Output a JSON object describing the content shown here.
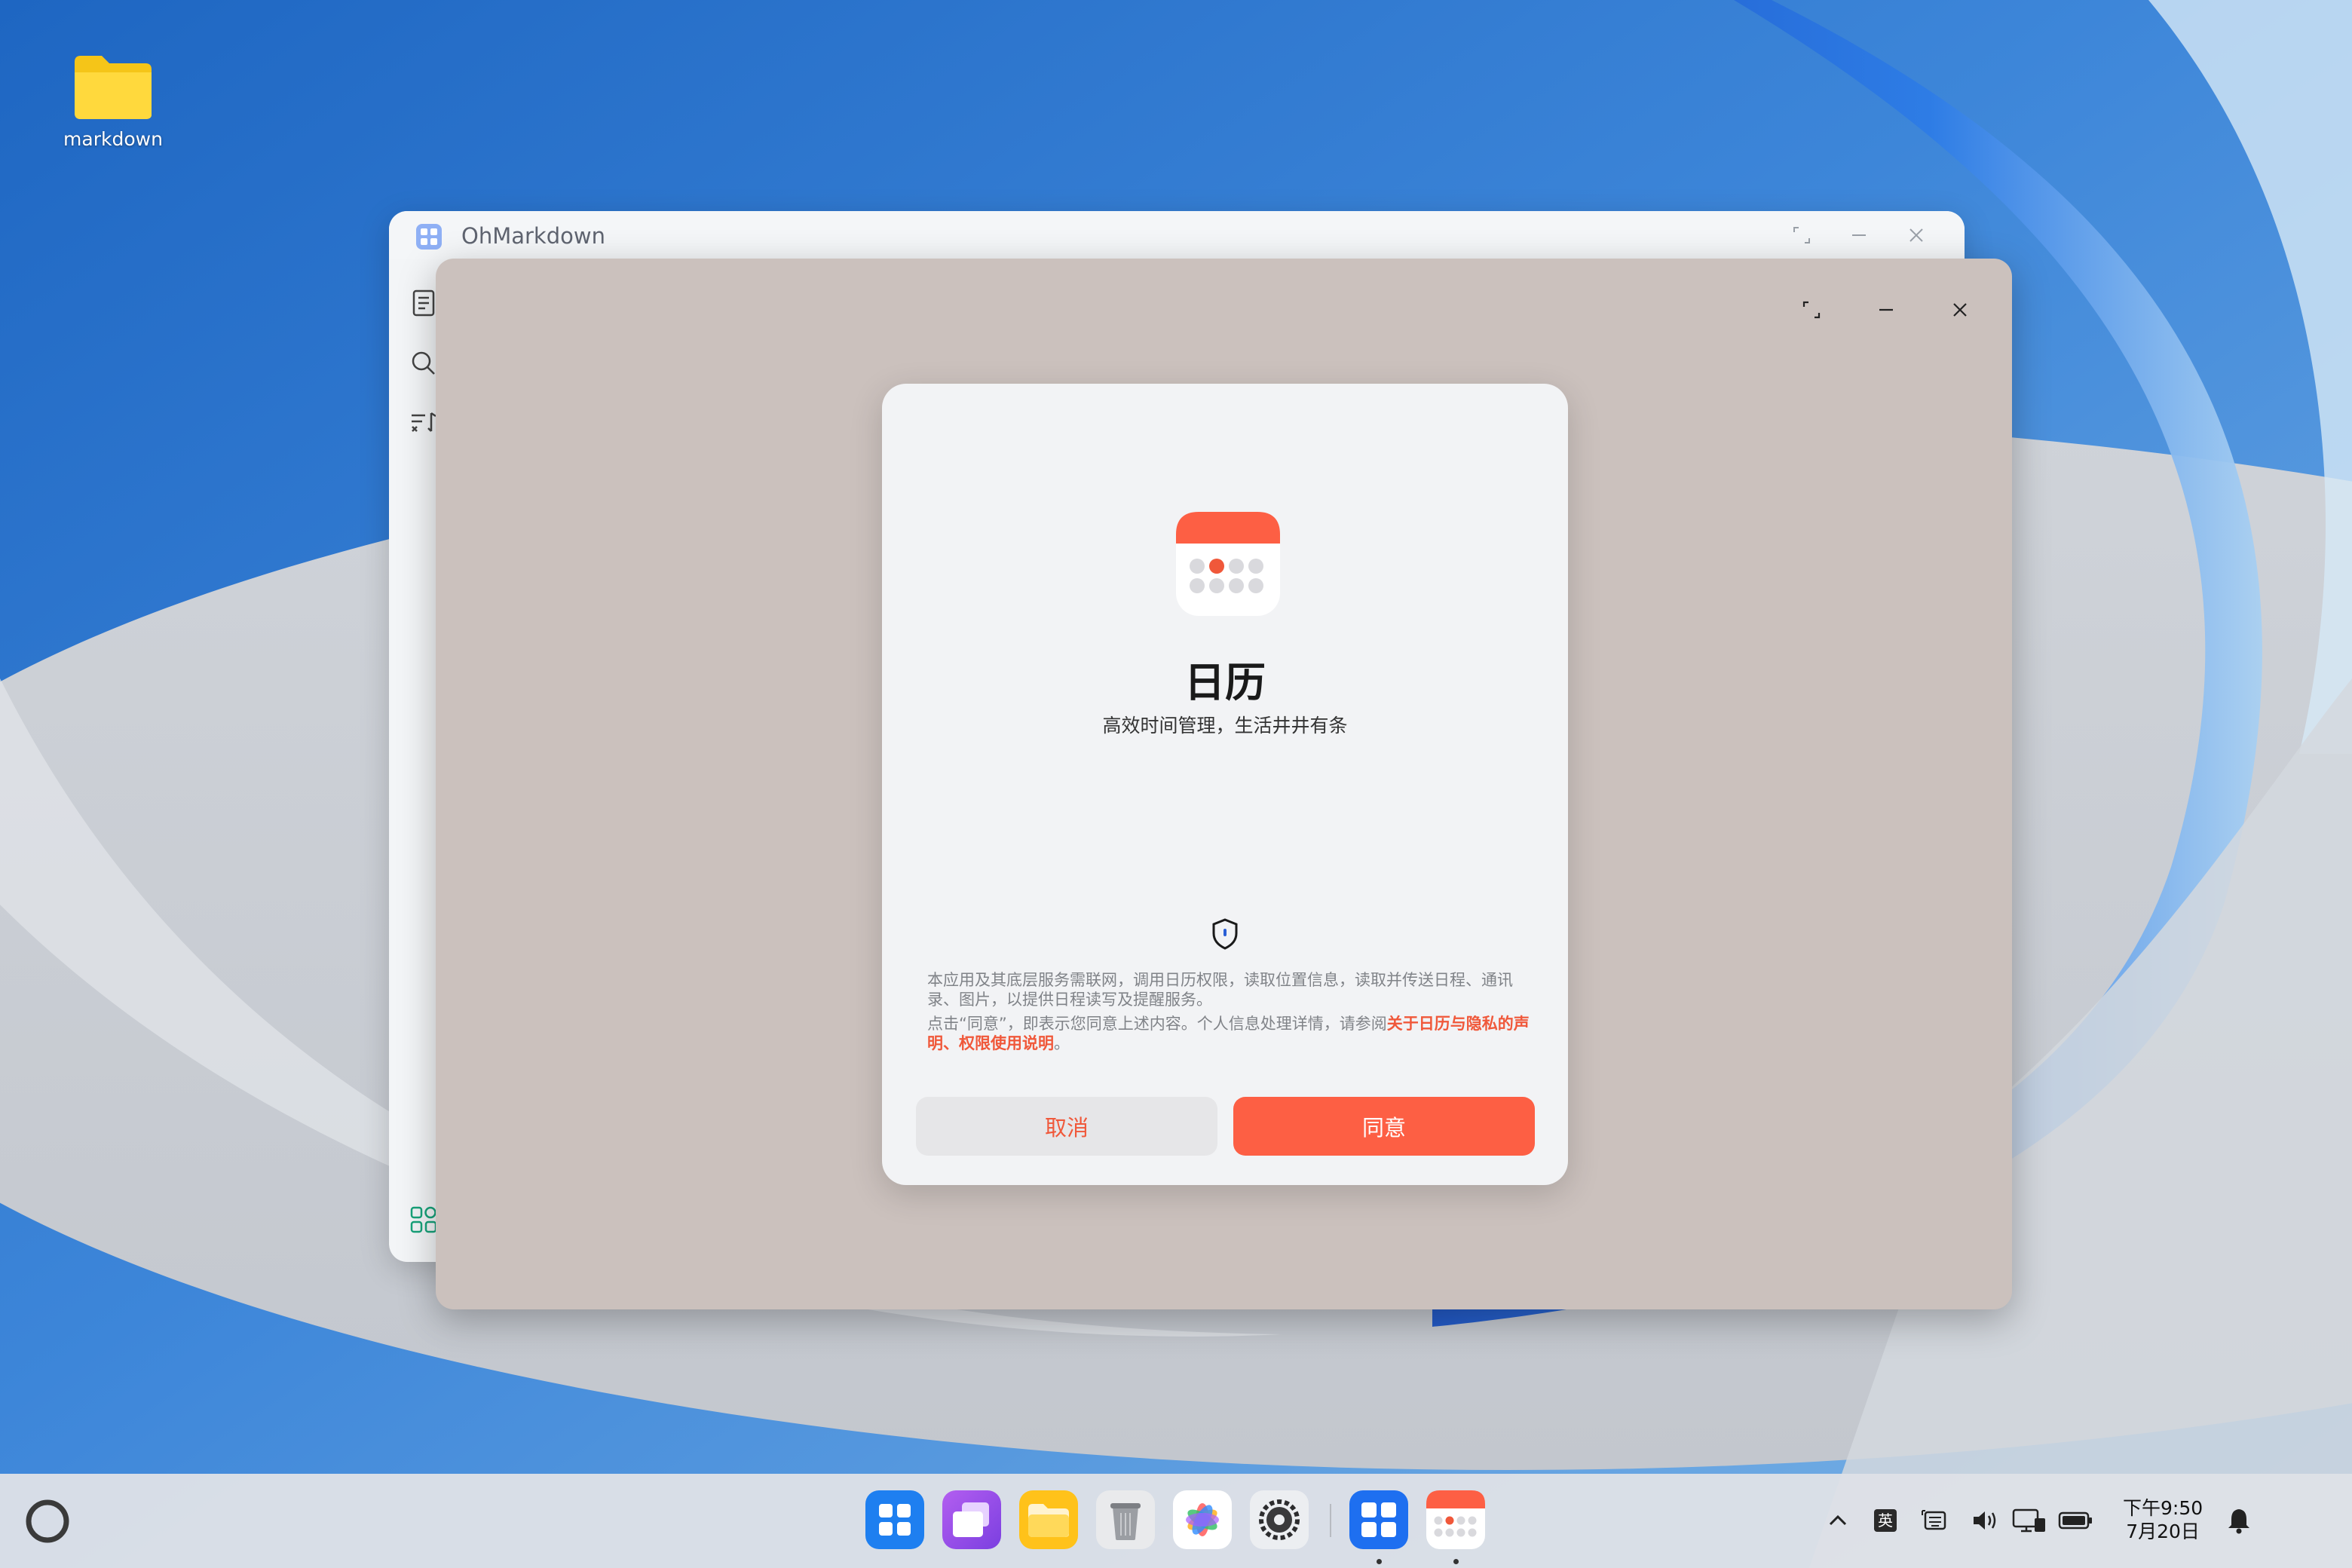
{
  "desktop": {
    "icons": [
      {
        "label": "markdown",
        "icon": "folder-icon"
      }
    ]
  },
  "back_window": {
    "title": "OhMarkdown",
    "sidebar_icons": [
      "document-icon",
      "search-icon",
      "sort-icon",
      "apps-icon"
    ]
  },
  "dialog": {
    "app_name": "日历",
    "slogan": "高效时间管理，生活井井有条",
    "privacy_line1": "本应用及其底层服务需联网，调用日历权限，读取位置信息，读取并传送日程、通讯录、图片，以提供日程读写及提醒服务。",
    "privacy_line2_prefix": "点击“同意”，即表示您同意上述内容。个人信息处理详情，请参阅",
    "privacy_link1": "关于日历与隐私的声明",
    "privacy_sep": "、",
    "privacy_link2": "权限使用说明",
    "privacy_end": "。",
    "cancel_label": "取消",
    "agree_label": "同意"
  },
  "taskbar": {
    "dock": [
      "app-center-icon",
      "multitask-icon",
      "files-icon",
      "trash-icon",
      "photos-icon",
      "settings-icon",
      "ohmarkdown-icon",
      "calendar-icon"
    ],
    "input_method": "英",
    "time": "下午9:50",
    "date": "7月20日"
  },
  "colors": {
    "accent": "#fd5f44",
    "link": "#f0583a",
    "window_bg": "#cbc1bd",
    "dialog_bg": "#f2f3f5"
  }
}
